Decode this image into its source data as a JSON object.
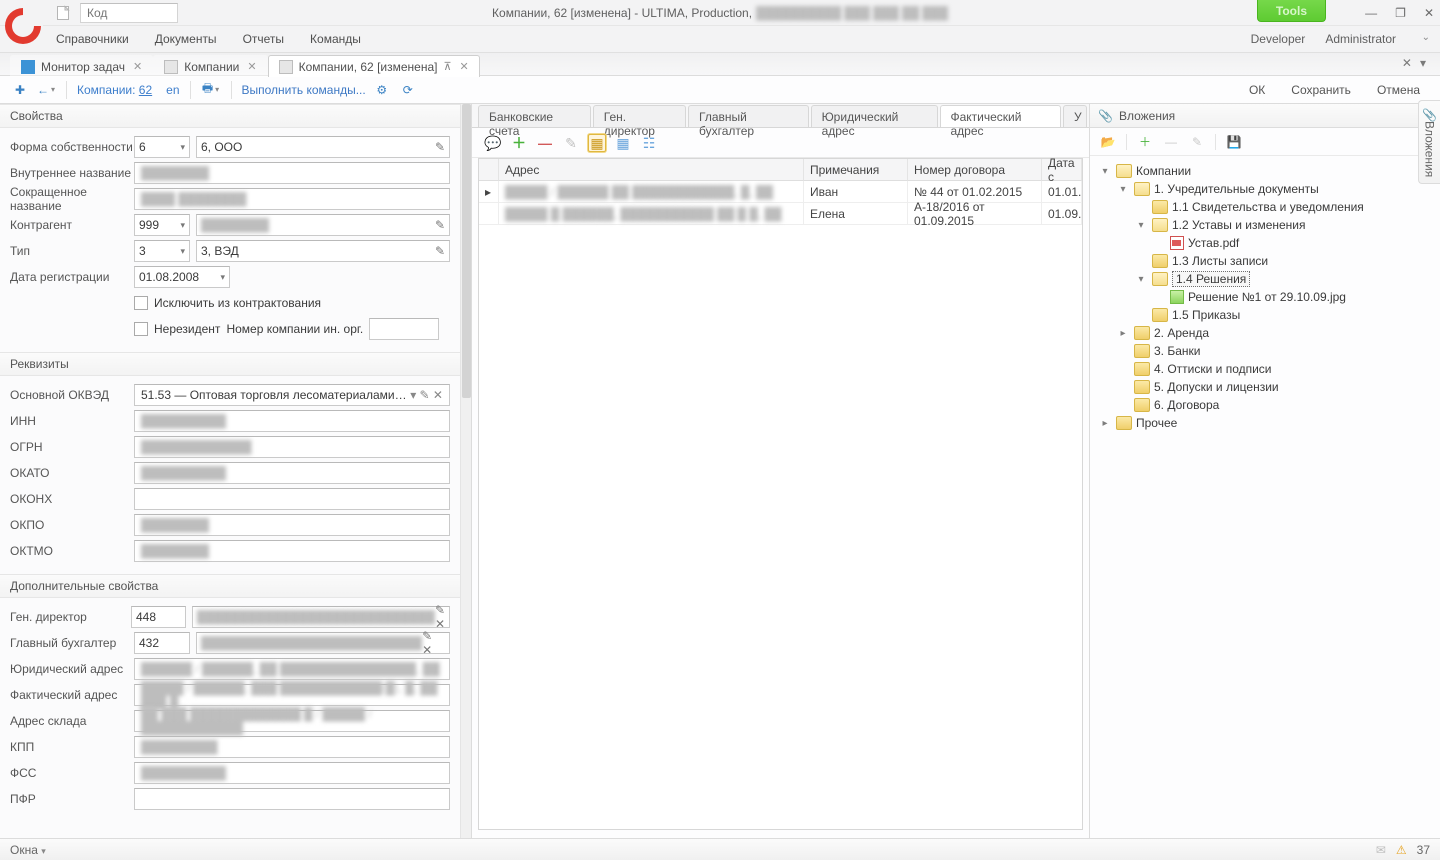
{
  "title": {
    "app": "Компании, 62 [изменена] - ULTIMA, Production,"
  },
  "code_placeholder": "Код",
  "tools": "Tools",
  "menus": {
    "ref": "Справочники",
    "doc": "Документы",
    "rep": "Отчеты",
    "cmd": "Команды",
    "dev": "Developer",
    "adm": "Administrator"
  },
  "doc_tabs": {
    "monitor": "Монитор задач",
    "companies": "Компании",
    "company62": "Компании, 62 [изменена]"
  },
  "toolbar": {
    "crumb_label": "Компании:",
    "crumb_num": "62",
    "locale": "en",
    "run": "Выполнить команды...",
    "ok": "ОК",
    "save": "Сохранить",
    "cancel": "Отмена"
  },
  "sections": {
    "props": "Свойства",
    "req": "Реквизиты",
    "extra": "Дополнительные свойства"
  },
  "props": {
    "form_label": "Форма собственности",
    "form_code": "6",
    "form_text": "6, ООО",
    "inner_label": "Внутреннее название",
    "inner_val": "████████",
    "short_label": "Сокращенное название",
    "short_val": "████ ████████",
    "contr_label": "Контрагент",
    "contr_code": "999",
    "contr_text": "████████",
    "type_label": "Тип",
    "type_code": "3",
    "type_text": "3, ВЭД",
    "reg_label": "Дата регистрации",
    "reg_date": "01.08.2008",
    "excl": "Исключить из контрактования",
    "nonres": "Нерезидент",
    "foreign_num": "Номер компании ин. орг."
  },
  "req": {
    "okved_label": "Основной ОКВЭД",
    "okved_val": "51.53 — Оптовая торговля лесоматериалами…",
    "inn_label": "ИНН",
    "inn_val": "██████████",
    "ogrn_label": "ОГРН",
    "ogrn_val": "█████████████",
    "okato_label": "ОКАТО",
    "okato_val": "██████████",
    "okonh_label": "ОКОНХ",
    "okonh_val": "",
    "okpo_label": "ОКПО",
    "okpo_val": "████████",
    "oktmo_label": "ОКТМО",
    "oktmo_val": "████████"
  },
  "extra": {
    "gd_label": "Ген. директор",
    "gd_code": "448",
    "gd_text": "████████████████████████████",
    "gb_label": "Главный бухгалтер",
    "gb_code": "432",
    "gb_text": "██████████████████████████",
    "legal_label": "Юридический адрес",
    "legal_val": "██████ / ██████, ██ ████████████████, ██",
    "fact_label": "Фактический адрес",
    "fact_val": "█████ / ██████, ███ ████████████(█), █, ██ ███ █",
    "wh_label": "Адрес склада",
    "wh_val": "██ ███ █████████████ █ / █████ /████████████",
    "kpp_label": "КПП",
    "kpp_val": "█████████",
    "fss_label": "ФСС",
    "fss_val": "██████████",
    "pfr_label": "ПФР",
    "pfr_val": ""
  },
  "center_tabs": {
    "t1": "Банковские счета",
    "t2": "Ген. директор",
    "t3": "Главный бухгалтер",
    "t4": "Юридический адрес",
    "t5": "Фактический адрес",
    "t6": "У"
  },
  "grid": {
    "h_addr": "Адрес",
    "h_note": "Примечания",
    "h_num": "Номер договора",
    "h_date": "Дата с",
    "r1_addr": "█████ / ██████ ██ ████████████, █, ██",
    "r1_note": "Иван",
    "r1_num": "№ 44 от 01.02.2015",
    "r1_date": "01.01.",
    "r2_addr": "█████ █ ██████, ███████████ ██ █ █, ██",
    "r2_note": "Елена",
    "r2_num": "А-18/2016 от 01.09.2015",
    "r2_date": "01.09."
  },
  "attachments": {
    "panel": "Вложения",
    "root": "Компании",
    "n1": "1. Учредительные документы",
    "n11": "1.1 Свидетельства и уведомления",
    "n12": "1.2 Уставы и изменения",
    "n12f": "Устав.pdf",
    "n13": "1.3 Листы записи",
    "n14": "1.4 Решения",
    "n14f": "Решение №1 от 29.10.09.jpg",
    "n15": "1.5 Приказы",
    "n2": "2. Аренда",
    "n3": "3. Банки",
    "n4": "4. Оттиски и подписи",
    "n5": "5. Допуски и лицензии",
    "n6": "6. Договора",
    "n7": "Прочее"
  },
  "status": {
    "windows": "Окна",
    "count": "37"
  },
  "sidebar_tab": "Вложения"
}
